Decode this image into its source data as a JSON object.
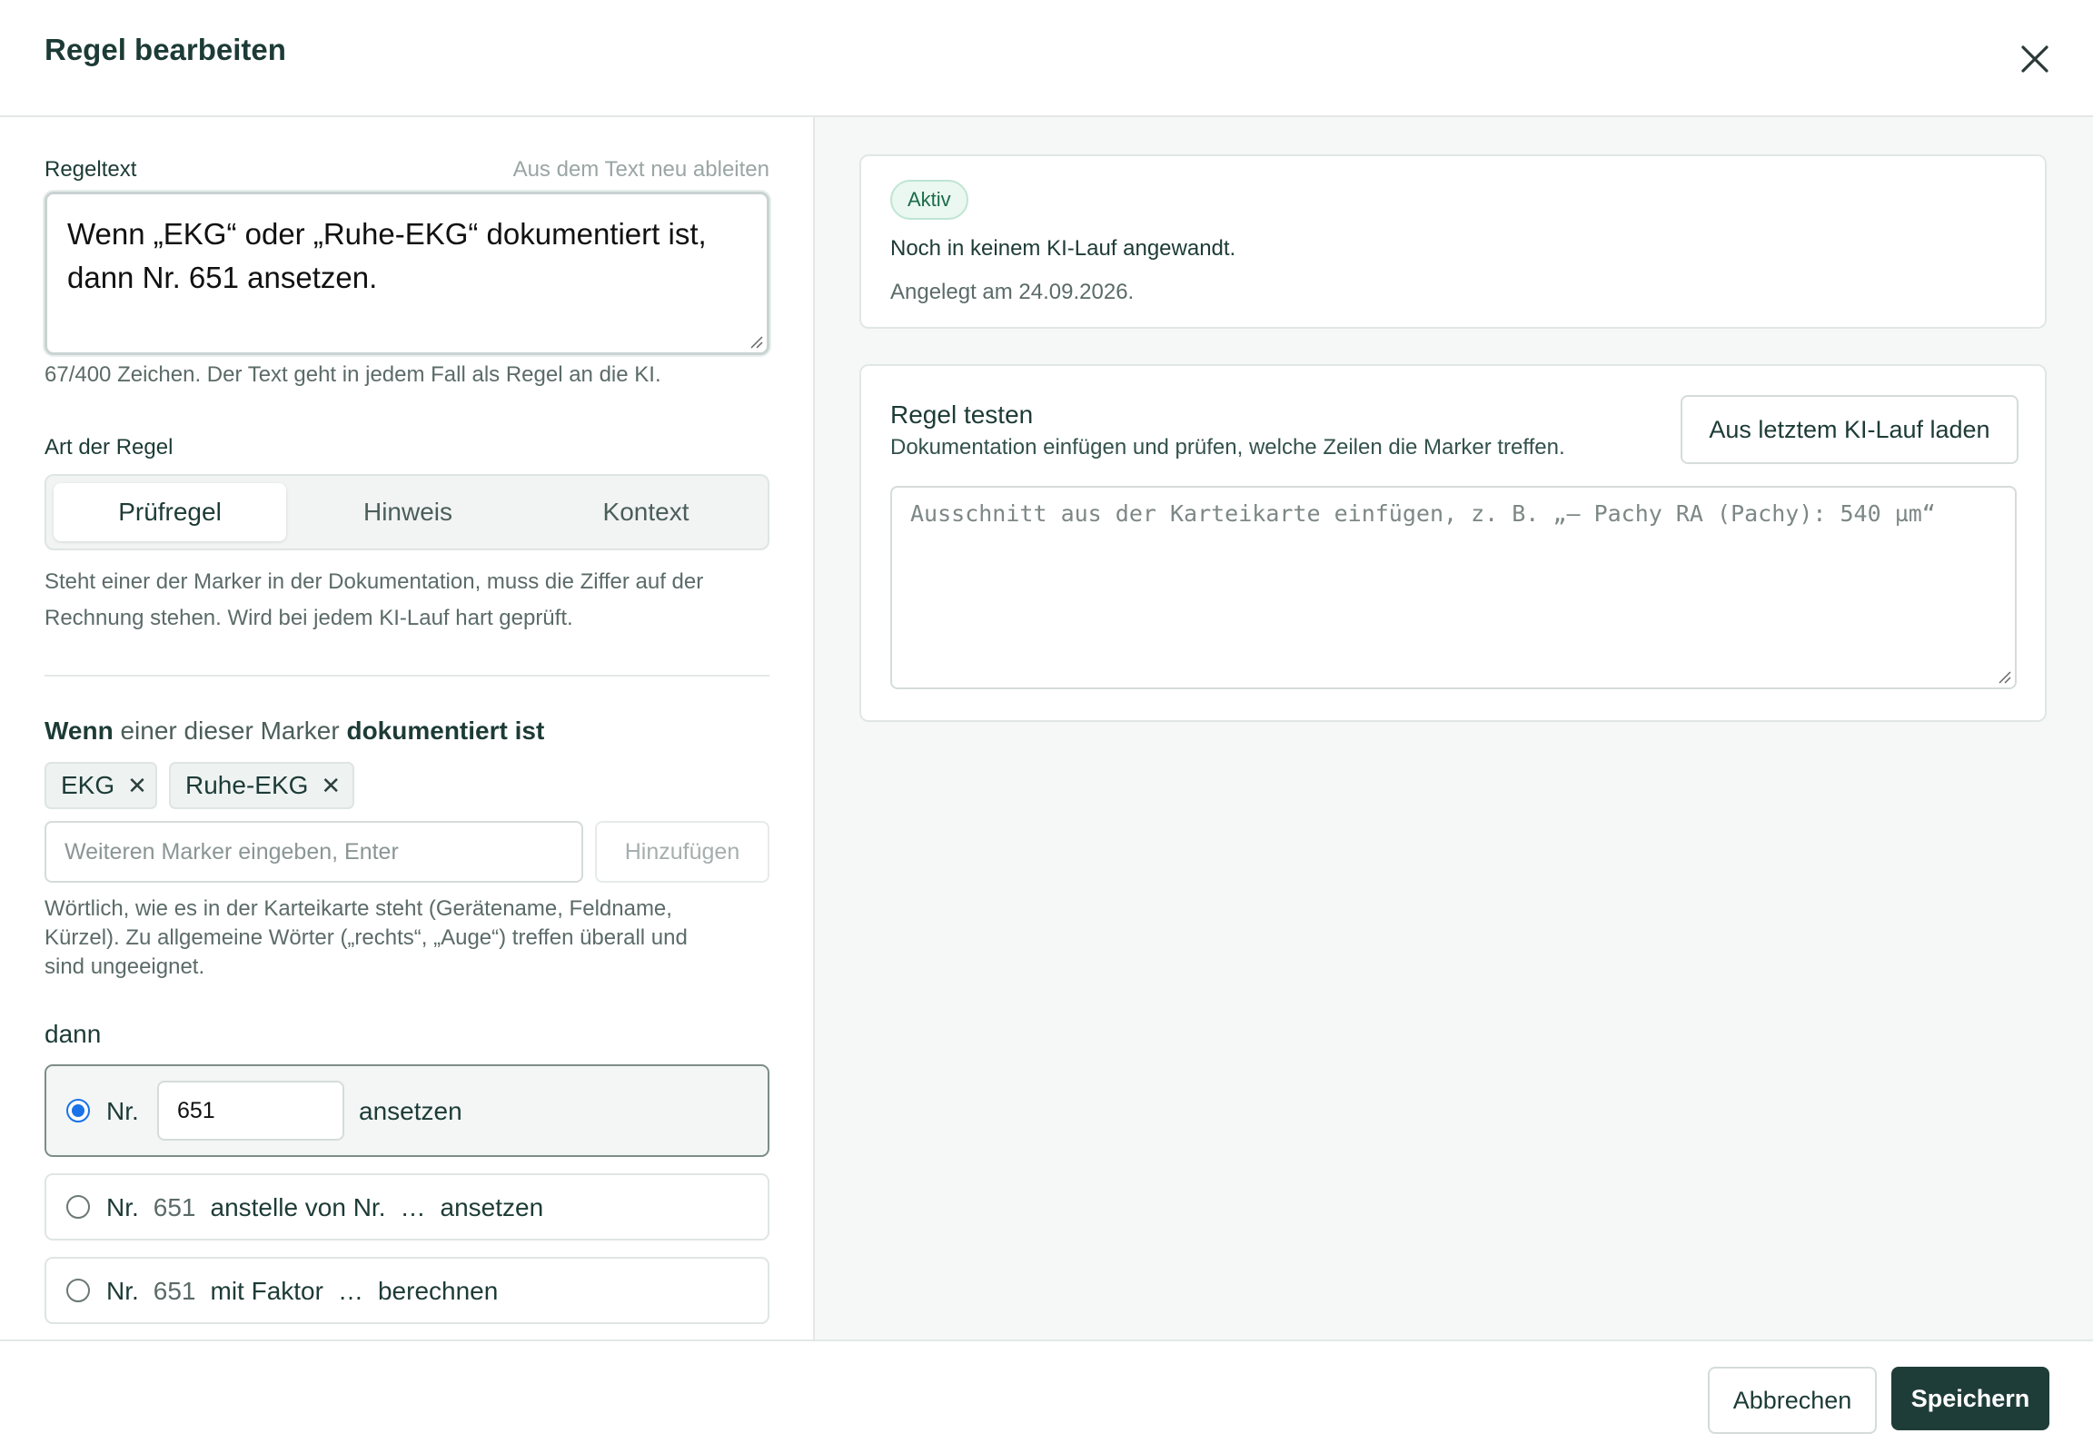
{
  "dialog": {
    "title": "Regel bearbeiten",
    "close_icon": "close-icon"
  },
  "rule_text": {
    "label": "Regeltext",
    "rederive_link": "Aus dem Text neu ableiten",
    "value_line1": "Wenn „EKG“ oder „Ruhe-EKG“ dokumentiert ist,",
    "value_line2": "dann Nr. 651 ansetzen.",
    "help": "67/400 Zeichen. Der Text geht in jedem Fall als Regel an die KI."
  },
  "rule_type": {
    "label": "Art der Regel",
    "options": [
      "Prüfregel",
      "Hinweis",
      "Kontext"
    ],
    "selected": "Prüfregel",
    "description_line1": "Steht einer der Marker in der Dokumentation, muss die Ziffer auf der",
    "description_line2": "Rechnung stehen. Wird bei jedem KI-Lauf hart geprüft."
  },
  "markers": {
    "heading_part1": "Wenn",
    "heading_part2": " einer dieser Marker ",
    "heading_part3": "dokumentiert ist",
    "chips": [
      "EKG",
      "Ruhe-EKG"
    ],
    "input_placeholder": "Weiteren Marker eingeben, Enter",
    "add_button": "Hinzufügen",
    "help_line1": "Wörtlich, wie es in der Karteikarte steht (Gerätename, Feldname,",
    "help_line2": "Kürzel). Zu allgemeine Wörter („rechts“, „Auge“) treffen überall und",
    "help_line3": "sind ungeeignet."
  },
  "action": {
    "heading": "dann",
    "option1": {
      "prefix": "Nr.",
      "number": "651",
      "suffix": "ansetzen",
      "selected": true
    },
    "option2": {
      "prefix": "Nr.",
      "number": "651",
      "middle": "anstelle von Nr.",
      "ellipsis": "…",
      "suffix": "ansetzen"
    },
    "option3": {
      "prefix": "Nr.",
      "number": "651",
      "middle": "mit Faktor",
      "ellipsis": "…",
      "suffix": "berechnen"
    }
  },
  "status_card": {
    "badge": "Aktiv",
    "line1": "Noch in keinem KI-Lauf angewandt.",
    "line2": "Angelegt am 24.09.2026."
  },
  "test_card": {
    "title": "Regel testen",
    "subtitle": "Dokumentation einfügen und prüfen, welche Zeilen die Marker treffen.",
    "load_button": "Aus letztem KI-Lauf laden",
    "placeholder": "Ausschnitt aus der Karteikarte einfügen, z. B. „– Pachy RA (Pachy): 540 µm“"
  },
  "footer": {
    "cancel": "Abbrechen",
    "save": "Speichern"
  },
  "colors": {
    "primary": "#1f3d38",
    "accent_radio": "#1a73e8",
    "badge_bg": "#eaf8f1",
    "badge_text": "#1b6b4a"
  }
}
